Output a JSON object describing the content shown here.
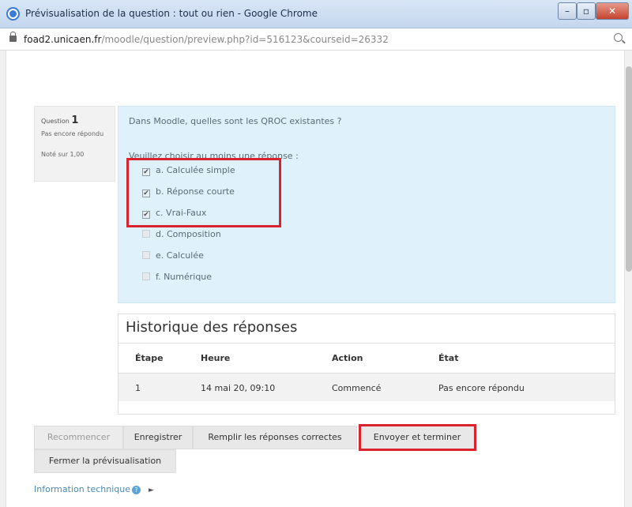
{
  "window": {
    "title": "Prévisualisation de la question : tout ou rien - Google Chrome",
    "min_symbol": "–",
    "max_symbol": "▫",
    "close_symbol": "✕"
  },
  "address": {
    "host": "foad2.unicaen.fr",
    "path": "/moodle/question/preview.php?id=516123&courseid=26332"
  },
  "question_info": {
    "label": "Question",
    "number": "1",
    "state": "Pas encore répondu",
    "grade": "Noté sur 1,00"
  },
  "question": {
    "text": "Dans Moodle, quelles sont les QROC existantes ?",
    "prompt": "Veuillez choisir au moins une réponse :",
    "answers": [
      {
        "label": "a. Calculée simple",
        "checked": true
      },
      {
        "label": "b. Réponse courte",
        "checked": true
      },
      {
        "label": "c. Vrai-Faux",
        "checked": true
      },
      {
        "label": "d. Composition",
        "checked": false
      },
      {
        "label": "e. Calculée",
        "checked": false
      },
      {
        "label": "f. Numérique",
        "checked": false
      }
    ],
    "check_mark": "✔"
  },
  "history": {
    "title": "Historique des réponses",
    "columns": [
      "Étape",
      "Heure",
      "Action",
      "État"
    ],
    "rows": [
      [
        "1",
        "14 mai 20, 09:10",
        "Commencé",
        "Pas encore répondu"
      ]
    ]
  },
  "buttons": {
    "restart": "Recommencer",
    "save": "Enregistrer",
    "fill_correct": "Remplir les réponses correctes",
    "submit": "Envoyer et terminer",
    "close": "Fermer la prévisualisation"
  },
  "tech_info": {
    "label": "Information technique",
    "help_symbol": "?",
    "expand_symbol": "►"
  },
  "colors": {
    "formulation_bg": "#dff1fa",
    "highlight": "#d9242d",
    "link": "#4b8ab0"
  }
}
